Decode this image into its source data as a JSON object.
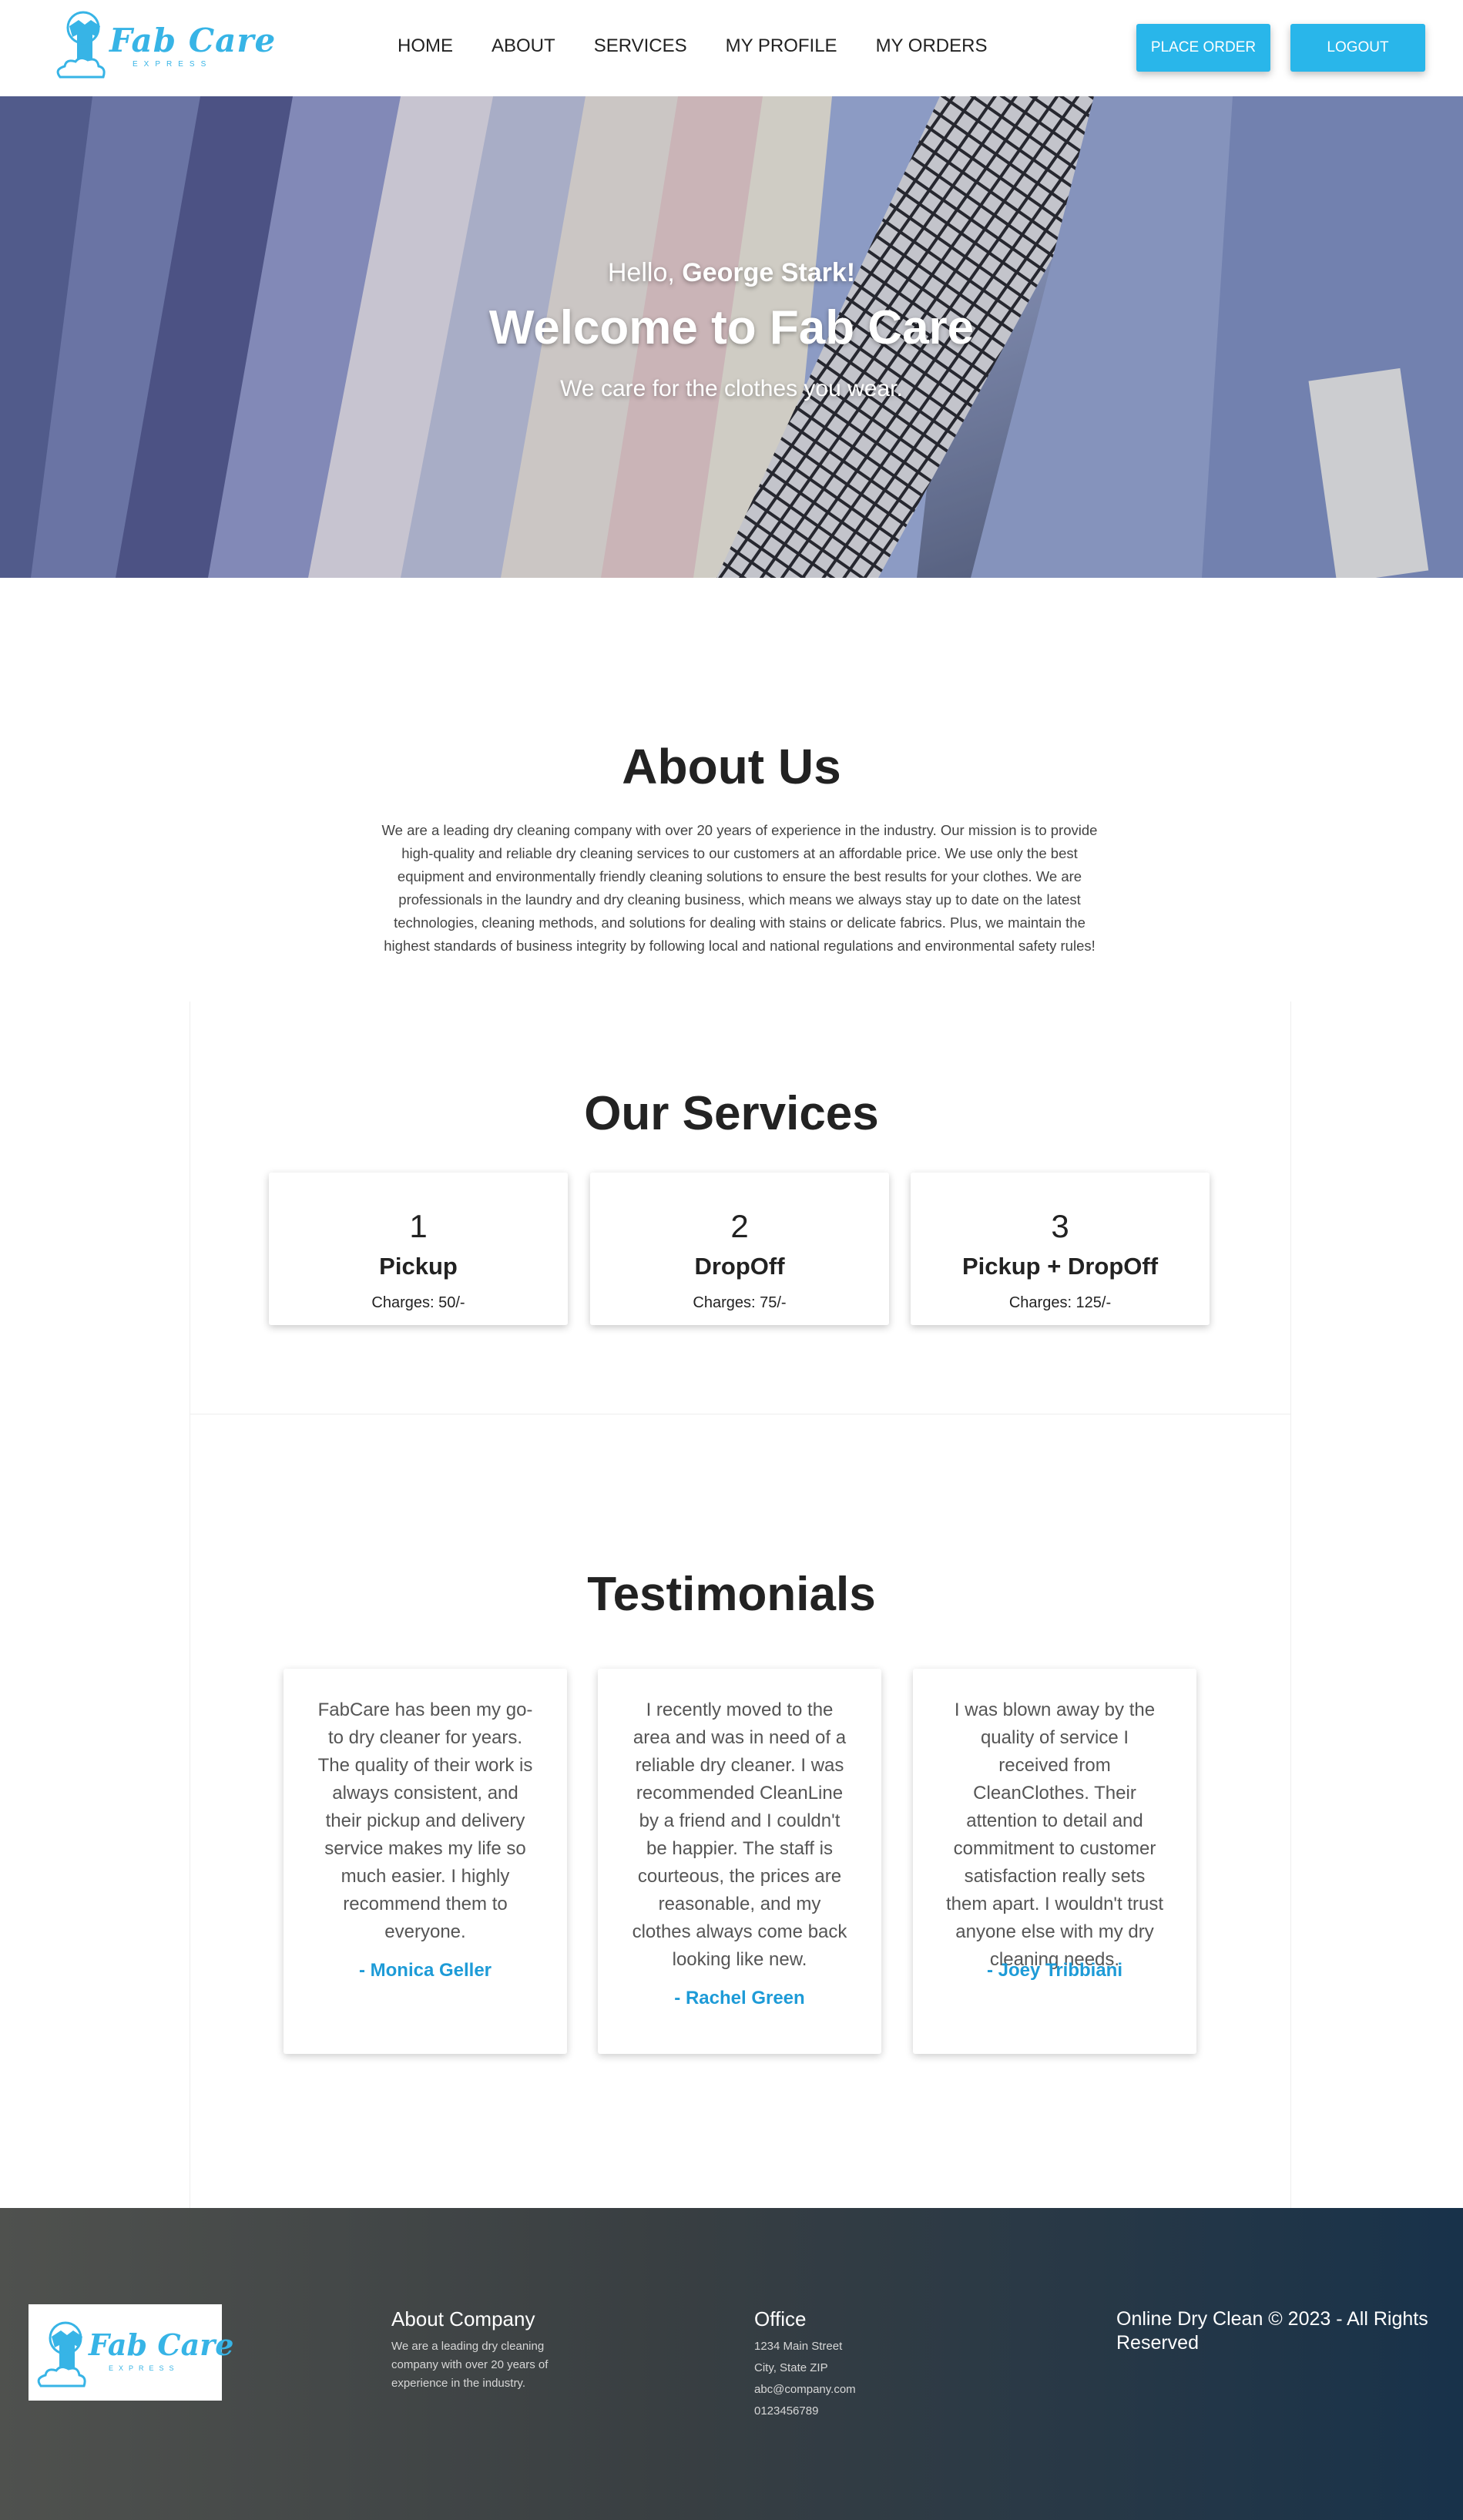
{
  "brand": {
    "name": "Fab Care",
    "tagline": "EXPRESS",
    "accent": "#29b6ea"
  },
  "nav": {
    "links": [
      "HOME",
      "ABOUT",
      "SERVICES",
      "MY PROFILE",
      "MY ORDERS"
    ],
    "place_order": "PLACE ORDER",
    "logout": "LOGOUT"
  },
  "hero": {
    "greeting": "Hello,",
    "user_name": "George Stark!",
    "title": "Welcome to Fab Care",
    "tagline": "We care for the clothes you wear."
  },
  "about": {
    "title": "About Us",
    "body": "We are a leading dry cleaning company with over 20 years of experience in the industry. Our mission is to provide high-quality and reliable dry cleaning services to our customers at an affordable price. We use only the best equipment and environmentally friendly cleaning solutions to ensure the best results for your clothes. We are professionals in the laundry and dry cleaning business, which means we always stay up to date on the latest technologies, cleaning methods, and solutions for dealing with stains or delicate fabrics. Plus, we maintain the highest standards of business integrity by following local and national regulations and environmental safety rules!"
  },
  "services": {
    "title": "Our Services",
    "items": [
      {
        "num": "1",
        "name": "Pickup",
        "price": "Charges: 50/-"
      },
      {
        "num": "2",
        "name": "DropOff",
        "price": "Charges: 75/-"
      },
      {
        "num": "3",
        "name": "Pickup + DropOff",
        "price": "Charges: 125/-"
      }
    ]
  },
  "testimonials": {
    "title": "Testimonials",
    "items": [
      {
        "quote": "FabCare has been my go-to dry cleaner for years. The quality of their work is always consistent, and their pickup and delivery service makes my life so much easier. I highly recommend them to everyone.",
        "author": "- Monica Geller"
      },
      {
        "quote": "I recently moved to the area and was in need of a reliable dry cleaner. I was recommended CleanLine by a friend and I couldn't be happier. The staff is courteous, the prices are reasonable, and my clothes always come back looking like new.",
        "author": "- Rachel Green"
      },
      {
        "quote": "I was blown away by the quality of service I received from CleanClothes. Their attention to detail and commitment to customer satisfaction really sets them apart. I wouldn't trust anyone else with my dry cleaning needs.",
        "author": "- Joey Tribbiani"
      }
    ]
  },
  "footer": {
    "about_title": "About Company",
    "about_text": "We are a leading dry cleaning company with over 20 years of experience in the industry.",
    "office_title": "Office",
    "office_lines": [
      "1234 Main Street",
      "City, State ZIP",
      "abc@company.com",
      "0123456789"
    ],
    "copyright": "Online Dry Clean © 2023 - All Rights Reserved"
  }
}
